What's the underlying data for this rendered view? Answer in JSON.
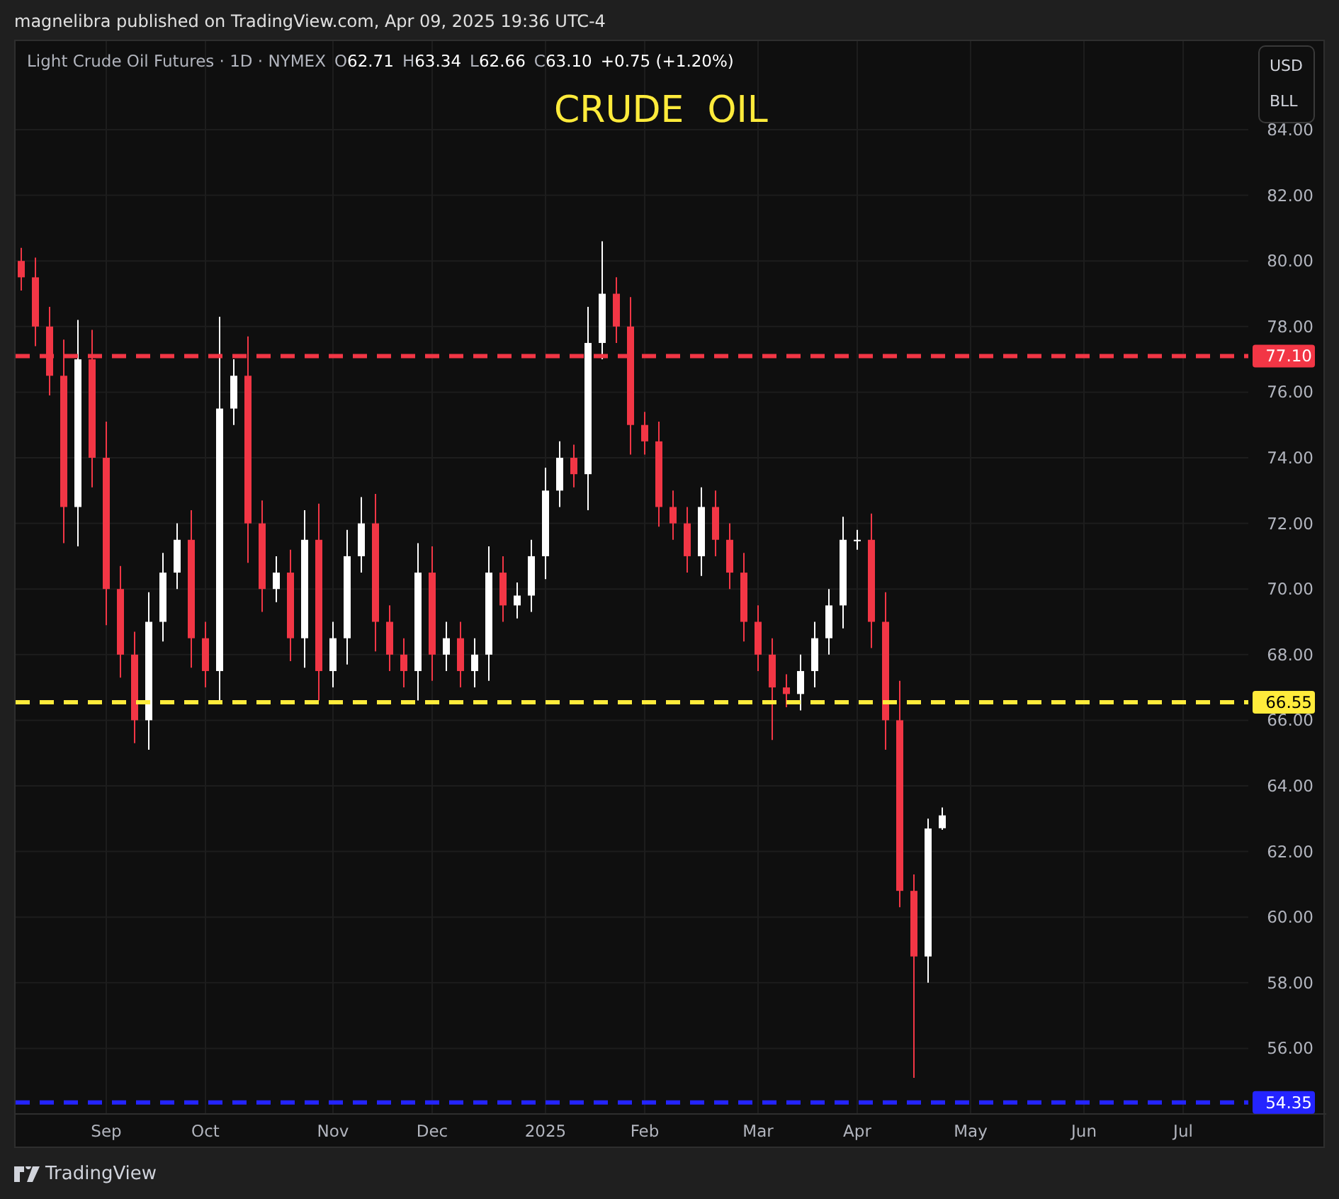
{
  "header": {
    "text": "magnelibra published on TradingView.com, Apr 09, 2025 19:36 UTC-4"
  },
  "legend": {
    "symbol": "Light Crude Oil Futures · 1D · NYMEX",
    "fields": [
      {
        "label": "O",
        "value": "62.71"
      },
      {
        "label": "H",
        "value": "63.34"
      },
      {
        "label": "L",
        "value": "62.66"
      },
      {
        "label": "C",
        "value": "63.10"
      }
    ],
    "change": "+0.75 (+1.20%)"
  },
  "title": "CRUDE  OIL",
  "scale_buttons": [
    "USD",
    "BLL"
  ],
  "chart": {
    "chart_data": {
      "type": "candlestick",
      "grid": true,
      "ylim": [
        54,
        86.7
      ],
      "yticks": [
        {
          "value": 84,
          "label": "84.00"
        },
        {
          "value": 82,
          "label": "82.00"
        },
        {
          "value": 80,
          "label": "80.00"
        },
        {
          "value": 78,
          "label": "78.00"
        },
        {
          "value": 76,
          "label": "76.00"
        },
        {
          "value": 74,
          "label": "74.00"
        },
        {
          "value": 72,
          "label": "72.00"
        },
        {
          "value": 70,
          "label": "70.00"
        },
        {
          "value": 68,
          "label": "68.00"
        },
        {
          "value": 66,
          "label": "66.00"
        },
        {
          "value": 64,
          "label": "64.00"
        },
        {
          "value": 62,
          "label": "62.00"
        },
        {
          "value": 60,
          "label": "60.00"
        },
        {
          "value": 58,
          "label": "58.00"
        },
        {
          "value": 56,
          "label": "56.00"
        }
      ],
      "categories": [
        null,
        null,
        null,
        null,
        null,
        null,
        "Sep",
        null,
        null,
        null,
        null,
        null,
        null,
        "Oct",
        null,
        null,
        null,
        null,
        null,
        null,
        null,
        null,
        "Nov",
        null,
        null,
        null,
        null,
        null,
        null,
        "Dec",
        null,
        null,
        null,
        null,
        null,
        null,
        null,
        "2025",
        null,
        null,
        null,
        null,
        null,
        null,
        "Feb",
        null,
        null,
        null,
        null,
        null,
        null,
        null,
        "Mar",
        null,
        null,
        null,
        null,
        null,
        null,
        "Apr",
        null,
        null,
        null,
        null,
        null,
        null,
        null,
        "May",
        null,
        null,
        null,
        null,
        null,
        null,
        null,
        "Jun",
        null,
        null,
        null,
        null,
        null,
        null,
        "Jul",
        null,
        null,
        null,
        null
      ],
      "ohlc": [
        [
          80.0,
          80.4,
          79.1,
          79.5
        ],
        [
          79.5,
          80.1,
          77.4,
          78.0
        ],
        [
          78.0,
          78.6,
          75.9,
          76.5
        ],
        [
          76.5,
          77.6,
          71.4,
          72.5
        ],
        [
          72.5,
          78.2,
          71.3,
          77.0
        ],
        [
          77.0,
          77.9,
          73.1,
          74.0
        ],
        [
          74.0,
          75.1,
          68.9,
          70.0
        ],
        [
          70.0,
          70.7,
          67.3,
          68.0
        ],
        [
          68.0,
          68.7,
          65.3,
          66.0
        ],
        [
          66.0,
          69.9,
          65.1,
          69.0
        ],
        [
          69.0,
          71.1,
          68.4,
          70.5
        ],
        [
          70.5,
          72.0,
          70.0,
          71.5
        ],
        [
          71.5,
          72.4,
          67.6,
          68.5
        ],
        [
          68.5,
          69.0,
          67.0,
          67.5
        ],
        [
          67.5,
          78.3,
          66.6,
          75.5
        ],
        [
          75.5,
          77.0,
          75.0,
          76.5
        ],
        [
          76.5,
          77.7,
          70.8,
          72.0
        ],
        [
          72.0,
          72.7,
          69.3,
          70.0
        ],
        [
          70.0,
          71.0,
          69.6,
          70.5
        ],
        [
          70.5,
          71.2,
          67.8,
          68.5
        ],
        [
          68.5,
          72.4,
          67.6,
          71.5
        ],
        [
          71.5,
          72.6,
          66.6,
          67.5
        ],
        [
          67.5,
          69.0,
          67.0,
          68.5
        ],
        [
          68.5,
          71.8,
          67.7,
          71.0
        ],
        [
          71.0,
          72.8,
          70.5,
          72.0
        ],
        [
          72.0,
          72.9,
          68.1,
          69.0
        ],
        [
          69.0,
          69.5,
          67.5,
          68.0
        ],
        [
          68.0,
          68.5,
          67.0,
          67.5
        ],
        [
          67.5,
          71.4,
          66.6,
          70.5
        ],
        [
          70.5,
          71.3,
          67.2,
          68.0
        ],
        [
          68.0,
          69.0,
          67.5,
          68.5
        ],
        [
          68.5,
          69.0,
          67.0,
          67.5
        ],
        [
          67.5,
          68.5,
          67.0,
          68.0
        ],
        [
          68.0,
          71.3,
          67.2,
          70.5
        ],
        [
          70.5,
          71.0,
          69.0,
          69.5
        ],
        [
          69.5,
          70.2,
          69.1,
          69.8
        ],
        [
          69.8,
          71.5,
          69.3,
          71.0
        ],
        [
          71.0,
          73.7,
          70.3,
          73.0
        ],
        [
          73.0,
          74.5,
          72.5,
          74.0
        ],
        [
          74.0,
          74.4,
          73.1,
          73.5
        ],
        [
          73.5,
          78.6,
          72.4,
          77.5
        ],
        [
          77.5,
          80.6,
          77.0,
          79.0
        ],
        [
          79.0,
          79.5,
          77.5,
          78.0
        ],
        [
          78.0,
          78.9,
          74.1,
          75.0
        ],
        [
          75.0,
          75.4,
          74.1,
          74.5
        ],
        [
          74.5,
          75.1,
          71.9,
          72.5
        ],
        [
          72.5,
          73.0,
          71.5,
          72.0
        ],
        [
          72.0,
          72.5,
          70.5,
          71.0
        ],
        [
          71.0,
          73.1,
          70.4,
          72.5
        ],
        [
          72.5,
          73.0,
          71.0,
          71.5
        ],
        [
          71.5,
          72.0,
          70.0,
          70.5
        ],
        [
          70.5,
          71.1,
          68.4,
          69.0
        ],
        [
          69.0,
          69.5,
          67.5,
          68.0
        ],
        [
          68.0,
          68.5,
          65.4,
          67.0
        ],
        [
          67.0,
          67.4,
          66.4,
          66.8
        ],
        [
          66.8,
          68.0,
          66.3,
          67.5
        ],
        [
          67.5,
          69.0,
          67.0,
          68.5
        ],
        [
          68.5,
          70.0,
          68.0,
          69.5
        ],
        [
          69.5,
          72.2,
          68.8,
          71.5
        ],
        [
          71.5,
          71.8,
          71.2,
          71.5
        ],
        [
          71.5,
          72.3,
          68.2,
          69.0
        ],
        [
          69.0,
          69.9,
          65.1,
          66.0
        ],
        [
          66.0,
          67.2,
          60.3,
          60.8
        ],
        [
          60.8,
          61.3,
          55.1,
          58.8
        ],
        [
          58.8,
          63.0,
          58.0,
          62.7
        ],
        [
          62.71,
          63.34,
          62.66,
          63.1
        ],
        null,
        null,
        null,
        null,
        null,
        null,
        null,
        null,
        null,
        null,
        null,
        null,
        null,
        null,
        null,
        null,
        null,
        null,
        null,
        null,
        null
      ],
      "ref_lines": [
        {
          "axis": "y",
          "value": 77.1,
          "label": "77.10",
          "color": "#f23645"
        },
        {
          "axis": "y",
          "value": 66.55,
          "label": "66.55",
          "color": "#ffeb3b"
        },
        {
          "axis": "y",
          "value": 54.35,
          "label": "54.35",
          "color": "#2424ff"
        }
      ]
    }
  },
  "footer": {
    "brand": "TradingView"
  }
}
